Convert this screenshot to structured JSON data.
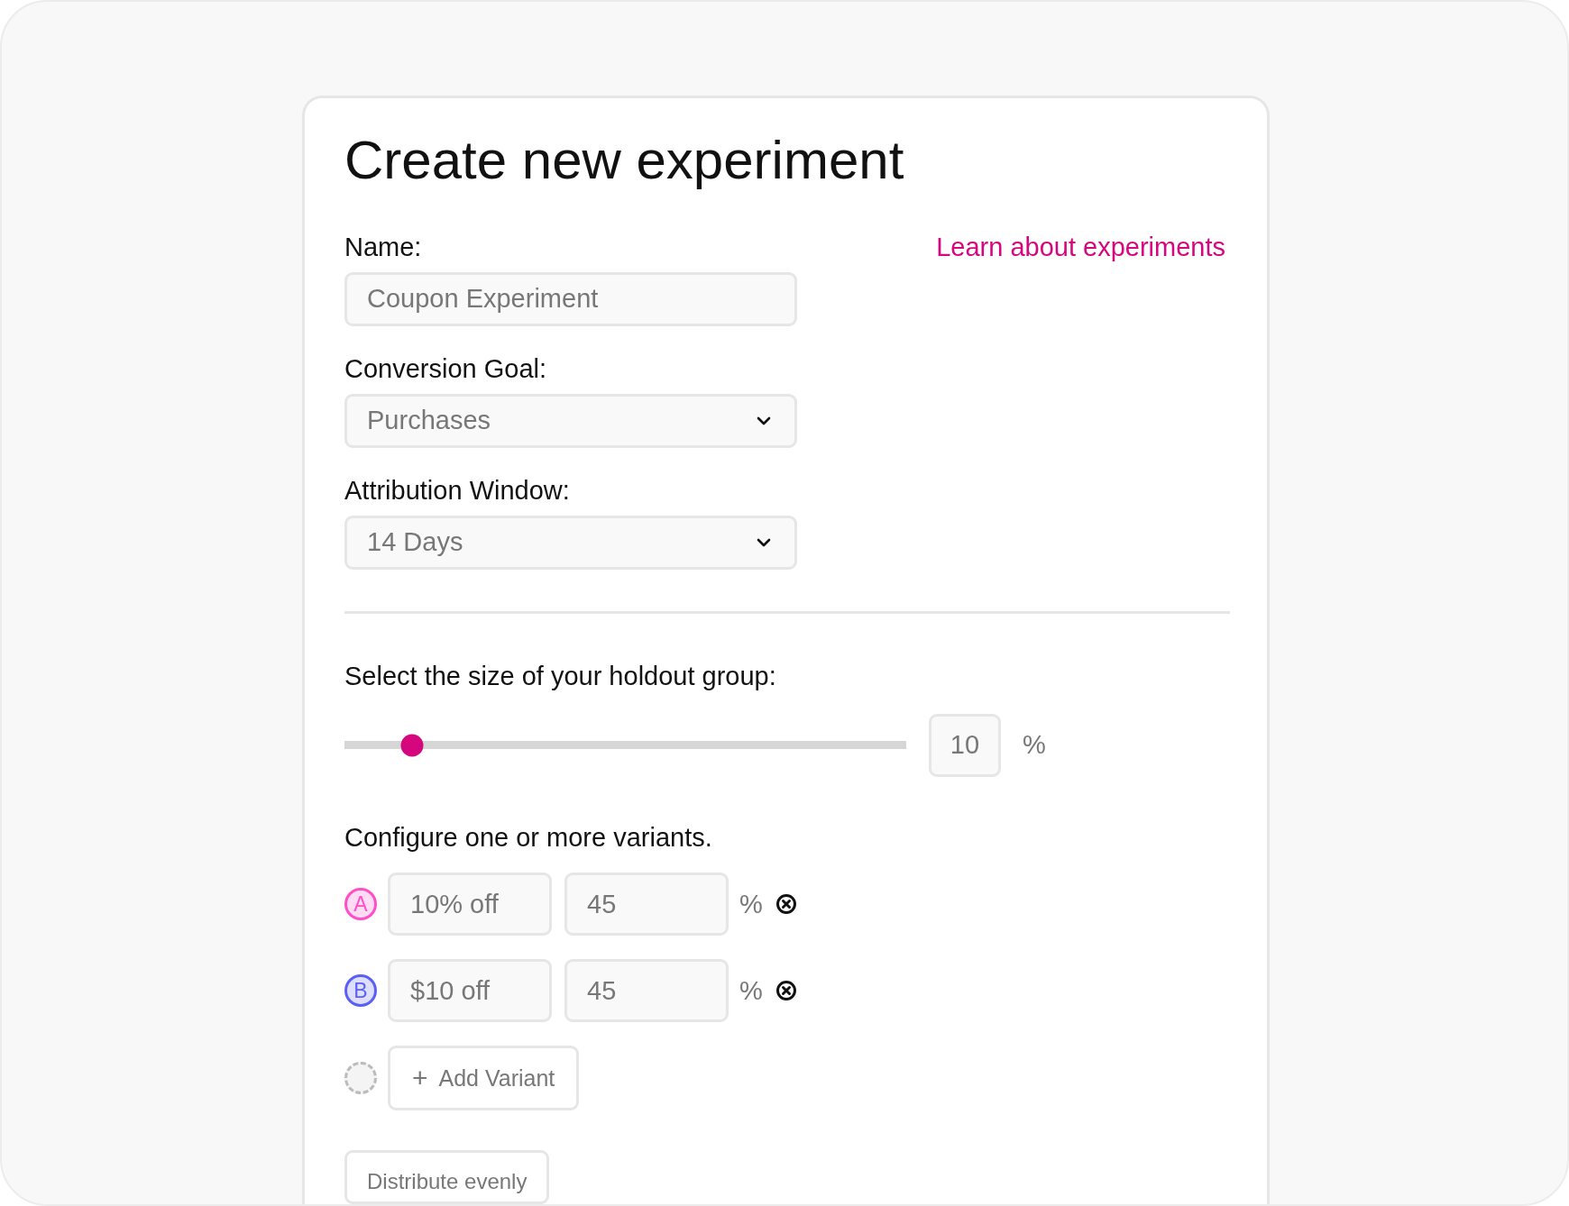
{
  "title": "Create new experiment",
  "learn_link": "Learn about experiments",
  "name_field": {
    "label": "Name:",
    "placeholder": "Coupon Experiment"
  },
  "selects": [
    {
      "label": "Conversion Goal:",
      "value": "Purchases"
    },
    {
      "label": "Attribution Window:",
      "value": "14 Days"
    }
  ],
  "holdout": {
    "label": "Select the size of your holdout group:",
    "level": 0.1,
    "value": "10",
    "unit": "%"
  },
  "variants_label": "Configure one or more variants.",
  "variants": [
    {
      "letter": "A",
      "color": "#ff4fc8",
      "name": "10% off",
      "share": "45",
      "unit": "%"
    },
    {
      "letter": "B",
      "color": "#5b5ff5",
      "name": "$10 off",
      "share": "45",
      "unit": "%"
    }
  ],
  "add_variant": {
    "icon": "+",
    "label": "Add Variant"
  },
  "distribute_button": "Distribute evenly"
}
